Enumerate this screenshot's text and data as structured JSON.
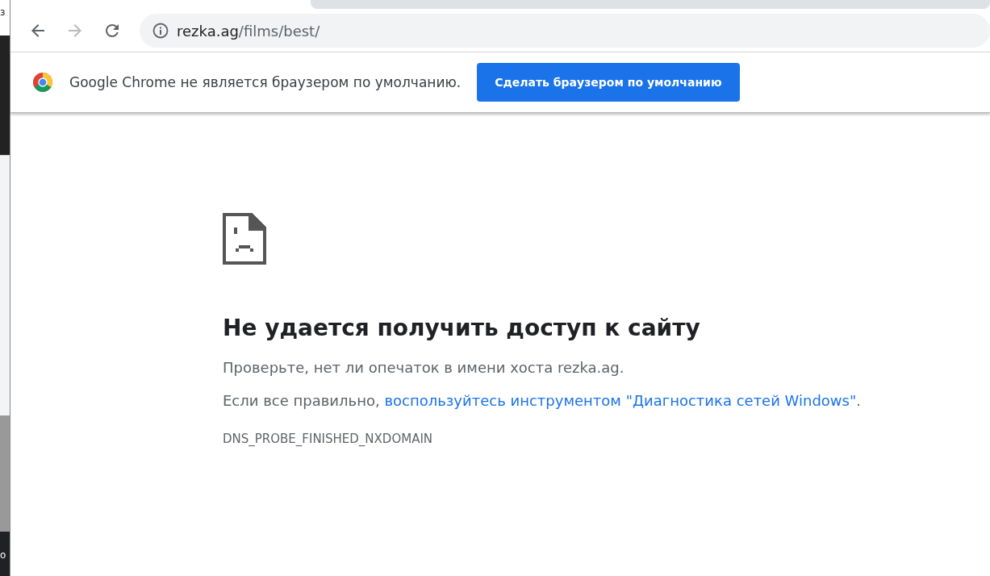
{
  "background_window": {
    "top_text": "з",
    "bottom_text": "o"
  },
  "toolbar": {
    "back_disabled": false,
    "forward_disabled": true,
    "url_host": "rezka.ag",
    "url_path": "/films/best/"
  },
  "infobar": {
    "message": "Google Chrome не является браузером по умолчанию.",
    "button": "Сделать браузером по умолчанию"
  },
  "error": {
    "title": "Не удается получить доступ к сайту",
    "hint": "Проверьте, нет ли опечаток в имени хоста rezka.ag.",
    "suggestion_prefix": "Если все правильно, ",
    "suggestion_link": "воспользуйтесь инструментом \"Диагностика сетей Windows\"",
    "suggestion_suffix": ".",
    "code": "DNS_PROBE_FINISHED_NXDOMAIN"
  }
}
